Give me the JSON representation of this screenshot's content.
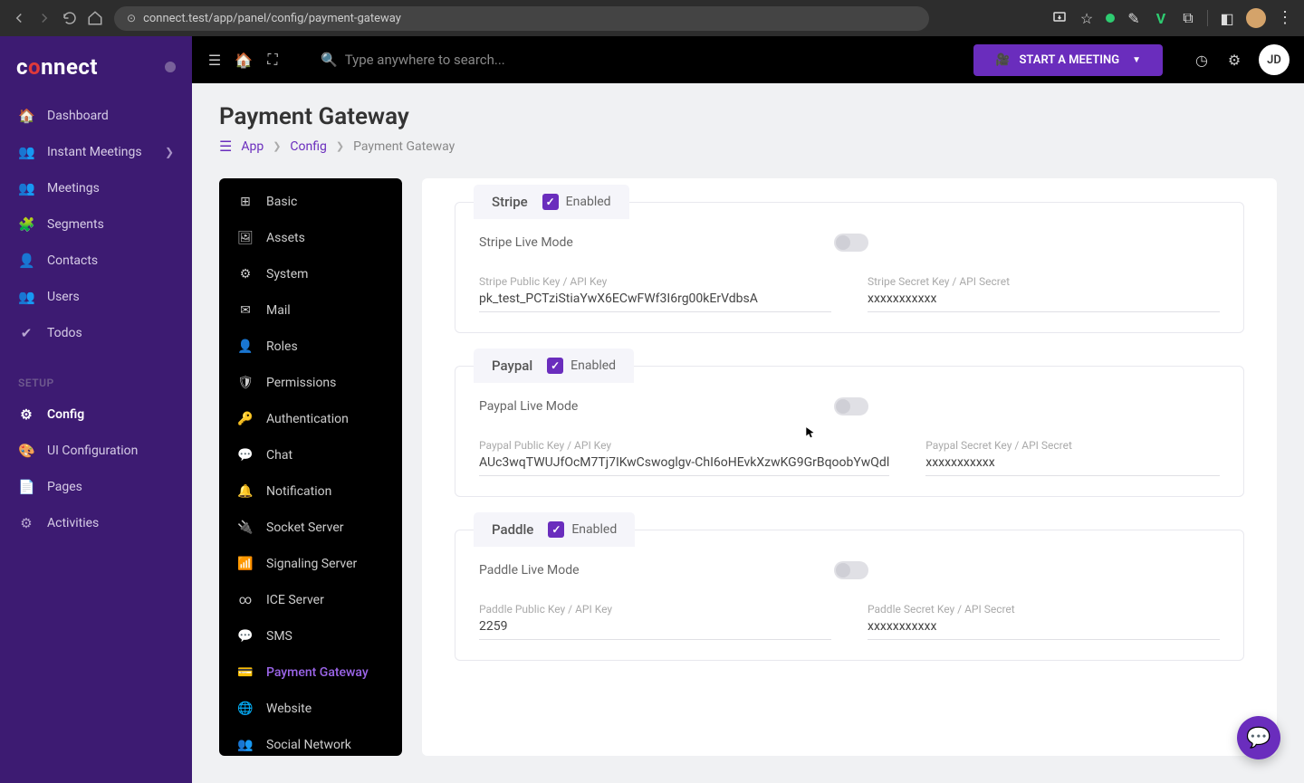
{
  "browser": {
    "url": "connect.test/app/panel/config/payment-gateway"
  },
  "logo": {
    "c": "c",
    "o": "o",
    "rest": "nnect"
  },
  "sidebar": {
    "items": [
      {
        "label": "Dashboard",
        "icon": "🏠"
      },
      {
        "label": "Instant Meetings",
        "icon": "👥",
        "chevron": true
      },
      {
        "label": "Meetings",
        "icon": "👥"
      },
      {
        "label": "Segments",
        "icon": "🧩"
      },
      {
        "label": "Contacts",
        "icon": "👤"
      },
      {
        "label": "Users",
        "icon": "👥"
      },
      {
        "label": "Todos",
        "icon": "✔"
      }
    ],
    "setup_title": "SETUP",
    "setup": [
      {
        "label": "Config",
        "icon": "⚙",
        "active": true
      },
      {
        "label": "UI Configuration",
        "icon": "🎨"
      },
      {
        "label": "Pages",
        "icon": "📄"
      },
      {
        "label": "Activities",
        "icon": "⚙"
      }
    ]
  },
  "topbar": {
    "search_placeholder": "Type anywhere to search...",
    "start_meeting": "START A MEETING",
    "avatar": "JD"
  },
  "page": {
    "title": "Payment Gateway",
    "crumbs": {
      "app": "App",
      "config": "Config",
      "current": "Payment Gateway"
    }
  },
  "config_nav": [
    {
      "label": "Basic",
      "icon": "⊞"
    },
    {
      "label": "Assets",
      "icon": "🖼"
    },
    {
      "label": "System",
      "icon": "⚙"
    },
    {
      "label": "Mail",
      "icon": "✉"
    },
    {
      "label": "Roles",
      "icon": "👤"
    },
    {
      "label": "Permissions",
      "icon": "🛡"
    },
    {
      "label": "Authentication",
      "icon": "🔑"
    },
    {
      "label": "Chat",
      "icon": "💬"
    },
    {
      "label": "Notification",
      "icon": "🔔"
    },
    {
      "label": "Socket Server",
      "icon": "🔌"
    },
    {
      "label": "Signaling Server",
      "icon": "📶"
    },
    {
      "label": "ICE Server",
      "icon": "∞"
    },
    {
      "label": "SMS",
      "icon": "💬"
    },
    {
      "label": "Payment Gateway",
      "icon": "💳",
      "active": true
    },
    {
      "label": "Website",
      "icon": "🌐"
    },
    {
      "label": "Social Network",
      "icon": "👥"
    }
  ],
  "gateways": [
    {
      "name": "Stripe",
      "enabled_label": "Enabled",
      "live_label": "Stripe Live Mode",
      "public_label": "Stripe Public Key / API Key",
      "public_value": "pk_test_PCTziStiaYwX6ECwFWf3I6rg00kErVdbsA",
      "secret_label": "Stripe Secret Key / API Secret",
      "secret_value": "xxxxxxxxxxx"
    },
    {
      "name": "Paypal",
      "enabled_label": "Enabled",
      "live_label": "Paypal Live Mode",
      "public_label": "Paypal Public Key / API Key",
      "public_value": "AUc3wqTWUJfOcM7Tj7IKwCswoglgv-ChI6oHEvkXzwKG9GrBqoobYwQdl",
      "secret_label": "Paypal Secret Key / API Secret",
      "secret_value": "xxxxxxxxxxx"
    },
    {
      "name": "Paddle",
      "enabled_label": "Enabled",
      "live_label": "Paddle Live Mode",
      "public_label": "Paddle Public Key / API Key",
      "public_value": "2259",
      "secret_label": "Paddle Secret Key / API Secret",
      "secret_value": "xxxxxxxxxxx"
    }
  ]
}
